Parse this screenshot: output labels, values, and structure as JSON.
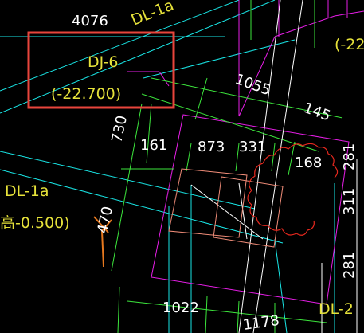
{
  "drawing": {
    "background": "#000000",
    "colors": {
      "cyan": "#19e6e6",
      "magenta": "#e61ee6",
      "green": "#3ce63c",
      "yellow": "#e6e23a",
      "white": "#ffffff",
      "red_box": "#e8453c",
      "red_cloud": "#e6281e",
      "salmon": "#f08c78",
      "orange": "#e6781e"
    },
    "labels": {
      "dim_4076": "4076",
      "beam_dl1a_top": "DL-1a",
      "beam_top_right": "(-22",
      "pile_cap_name": "DJ-6",
      "pile_cap_elev": "(-22.700)",
      "dim_1055": "1055",
      "dim_145": "145",
      "dim_730": "730",
      "dim_161": "161",
      "dim_873": "873",
      "dim_331": "331",
      "dim_168": "168",
      "dim_281_top": "281",
      "beam_dl1a_left": "DL-1a",
      "beam_elev_left": "高-0.500)",
      "dim_470": "470",
      "dim_311": "311",
      "dim_281_bottom": "281",
      "dim_1022": "1022",
      "dim_1178": "1178",
      "beam_dl2": "DL-2"
    }
  }
}
